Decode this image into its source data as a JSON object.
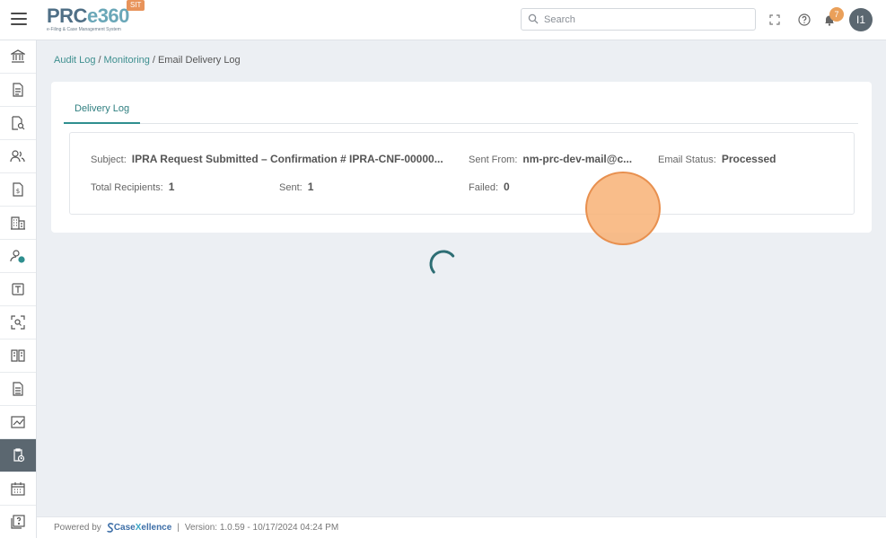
{
  "app": {
    "logo_text_a": "PRC",
    "logo_text_b": "e360",
    "logo_subtitle": "e-Filing & Case Management System",
    "env_badge": "SIT"
  },
  "header": {
    "search_placeholder": "Search",
    "notification_count": "7",
    "avatar_initials": "I1"
  },
  "sidebar": {
    "items": [
      {
        "icon": "bank-icon"
      },
      {
        "icon": "document-icon"
      },
      {
        "icon": "document-search-icon"
      },
      {
        "icon": "users-icon"
      },
      {
        "icon": "invoice-icon"
      },
      {
        "icon": "building-icon"
      },
      {
        "icon": "user-settings-icon"
      },
      {
        "icon": "template-icon"
      },
      {
        "icon": "scan-search-icon"
      },
      {
        "icon": "book-icon"
      },
      {
        "icon": "file-text-icon"
      },
      {
        "icon": "chart-icon"
      },
      {
        "icon": "clipboard-clock-icon",
        "active": true
      },
      {
        "icon": "calendar-icon"
      },
      {
        "icon": "help-docs-icon"
      }
    ]
  },
  "breadcrumb": {
    "item1": "Audit Log",
    "item2": "Monitoring",
    "current": "Email Delivery Log",
    "separator": "/"
  },
  "tabs": {
    "active": "Delivery Log"
  },
  "details": {
    "subject_label": "Subject:",
    "subject_value": "IPRA Request Submitted – Confirmation # IPRA-CNF-00000...",
    "sent_from_label": "Sent From:",
    "sent_from_value": "nm-prc-dev-mail@c...",
    "status_label": "Email Status:",
    "status_value": "Processed",
    "total_label": "Total Recipients:",
    "total_value": "1",
    "sent_label": "Sent:",
    "sent_value": "1",
    "failed_label": "Failed:",
    "failed_value": "0"
  },
  "footer": {
    "powered_by": "Powered by",
    "brand_a": "Case",
    "brand_b": "X",
    "brand_c": "ellence",
    "separator": "|",
    "version": "Version: 1.0.59 - 10/17/2024 04:24 PM"
  },
  "colors": {
    "accent": "#2f8f8f",
    "badge": "#eaa05a",
    "sidebar_active": "#5b6770"
  }
}
